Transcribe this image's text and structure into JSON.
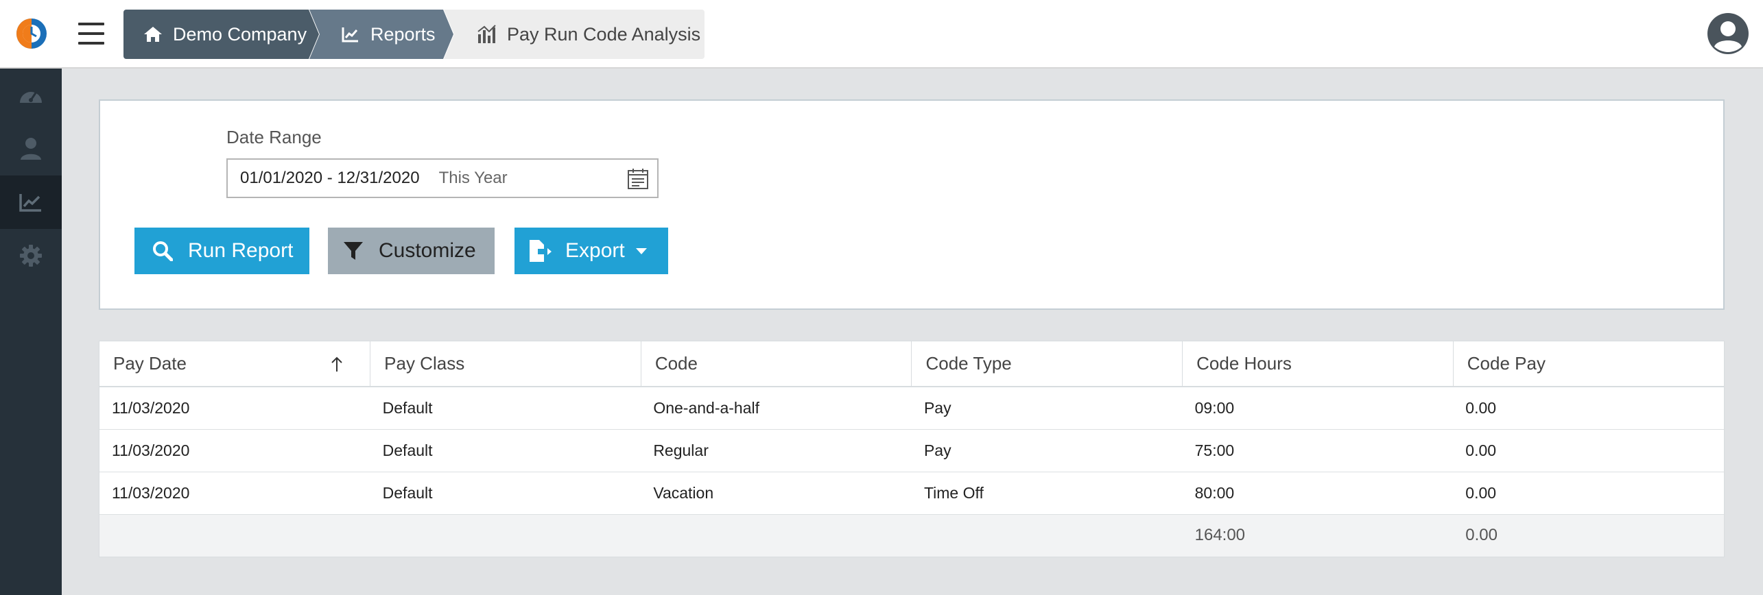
{
  "breadcrumbs": [
    {
      "label": "Demo Company",
      "icon": "home-icon"
    },
    {
      "label": "Reports",
      "icon": "chart-line-icon"
    },
    {
      "label": "Pay Run Code Analysis",
      "icon": "bar-chart-icon"
    }
  ],
  "sidebar": {
    "items": [
      {
        "icon": "dashboard-gauge-icon",
        "active": false
      },
      {
        "icon": "employee-icon",
        "active": false
      },
      {
        "icon": "reports-chart-icon",
        "active": true
      },
      {
        "icon": "settings-gear-icon",
        "active": false
      }
    ]
  },
  "filters": {
    "date_range_label": "Date Range",
    "date_range_value": "01/01/2020 - 12/31/2020",
    "date_range_preset": "This Year"
  },
  "buttons": {
    "run_report": "Run Report",
    "customize": "Customize",
    "export": "Export"
  },
  "table": {
    "columns": [
      "Pay Date",
      "Pay Class",
      "Code",
      "Code Type",
      "Code Hours",
      "Code Pay"
    ],
    "sort_column": "Pay Date",
    "sort_direction": "ascending",
    "rows": [
      [
        "11/03/2020",
        "Default",
        "One-and-a-half",
        "Pay",
        "09:00",
        "0.00"
      ],
      [
        "11/03/2020",
        "Default",
        "Regular",
        "Pay",
        "75:00",
        "0.00"
      ],
      [
        "11/03/2020",
        "Default",
        "Vacation",
        "Time Off",
        "80:00",
        "0.00"
      ]
    ],
    "totals": {
      "code_hours": "164:00",
      "code_pay": "0.00"
    }
  },
  "colors": {
    "primary": "#21a1d5",
    "sidebar_bg": "#26313a",
    "crumb_dark": "#4b5c69",
    "crumb_mid": "#66798a",
    "logo_orange": "#f07c1a",
    "logo_blue": "#1b6fb8"
  }
}
